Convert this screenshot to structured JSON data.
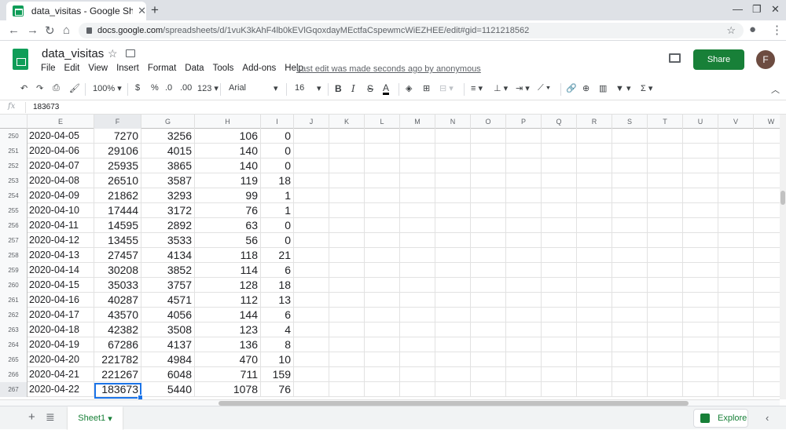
{
  "browser": {
    "tab_title": "data_visitas - Google Shee",
    "url_host": "docs.google.com",
    "url_path": "/spreadsheets/d/1vuK3kAhF4lb0kEVlGqoxdayMEctfaCspewmcWiEZHEE/edit#gid=1121218562"
  },
  "doc": {
    "title": "data_visitas",
    "menus": [
      "File",
      "Edit",
      "View",
      "Insert",
      "Format",
      "Data",
      "Tools",
      "Add-ons",
      "Help"
    ],
    "last_edit": "Last edit was made seconds ago by anonymous",
    "share_label": "Share",
    "avatar_letter": "F"
  },
  "toolbar": {
    "zoom": "100%",
    "currency": "$",
    "percent": "%",
    "dec_less": ".0",
    "dec_more": ".00",
    "format_more": "123",
    "font": "Arial",
    "font_size": "16"
  },
  "formula_bar": {
    "fx": "fx",
    "value": "183673"
  },
  "columns": [
    "E",
    "F",
    "G",
    "H",
    "I",
    "J",
    "K",
    "L",
    "M",
    "N",
    "O",
    "P",
    "Q",
    "R",
    "S",
    "T",
    "U",
    "V",
    "W"
  ],
  "rows": [
    {
      "n": "250",
      "e": "2020-04-05",
      "f": "7270",
      "g": "3256",
      "h": "106",
      "i": "0"
    },
    {
      "n": "251",
      "e": "2020-04-06",
      "f": "29106",
      "g": "4015",
      "h": "140",
      "i": "0"
    },
    {
      "n": "252",
      "e": "2020-04-07",
      "f": "25935",
      "g": "3865",
      "h": "140",
      "i": "0"
    },
    {
      "n": "253",
      "e": "2020-04-08",
      "f": "26510",
      "g": "3587",
      "h": "119",
      "i": "18"
    },
    {
      "n": "254",
      "e": "2020-04-09",
      "f": "21862",
      "g": "3293",
      "h": "99",
      "i": "1"
    },
    {
      "n": "255",
      "e": "2020-04-10",
      "f": "17444",
      "g": "3172",
      "h": "76",
      "i": "1"
    },
    {
      "n": "256",
      "e": "2020-04-11",
      "f": "14595",
      "g": "2892",
      "h": "63",
      "i": "0"
    },
    {
      "n": "257",
      "e": "2020-04-12",
      "f": "13455",
      "g": "3533",
      "h": "56",
      "i": "0"
    },
    {
      "n": "258",
      "e": "2020-04-13",
      "f": "27457",
      "g": "4134",
      "h": "118",
      "i": "21"
    },
    {
      "n": "259",
      "e": "2020-04-14",
      "f": "30208",
      "g": "3852",
      "h": "114",
      "i": "6"
    },
    {
      "n": "260",
      "e": "2020-04-15",
      "f": "35033",
      "g": "3757",
      "h": "128",
      "i": "18"
    },
    {
      "n": "261",
      "e": "2020-04-16",
      "f": "40287",
      "g": "4571",
      "h": "112",
      "i": "13"
    },
    {
      "n": "262",
      "e": "2020-04-17",
      "f": "43570",
      "g": "4056",
      "h": "144",
      "i": "6"
    },
    {
      "n": "263",
      "e": "2020-04-18",
      "f": "42382",
      "g": "3508",
      "h": "123",
      "i": "4"
    },
    {
      "n": "264",
      "e": "2020-04-19",
      "f": "67286",
      "g": "4137",
      "h": "136",
      "i": "8"
    },
    {
      "n": "265",
      "e": "2020-04-20",
      "f": "221782",
      "g": "4984",
      "h": "470",
      "i": "10"
    },
    {
      "n": "266",
      "e": "2020-04-21",
      "f": "221267",
      "g": "6048",
      "h": "711",
      "i": "159"
    },
    {
      "n": "267",
      "e": "2020-04-22",
      "f": "183673",
      "g": "5440",
      "h": "1078",
      "i": "76"
    }
  ],
  "sheets": {
    "active": "Sheet1",
    "explore_label": "Explore"
  }
}
